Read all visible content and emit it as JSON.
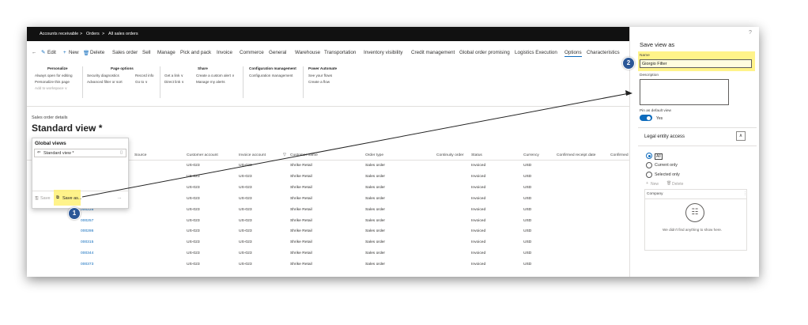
{
  "breadcrumb": {
    "item1": "Accounts receivable",
    "item2": "Orders",
    "item3": "All sales orders"
  },
  "actionbar": {
    "back": "←",
    "edit": "Edit",
    "new": "New",
    "delete": "Delete",
    "tabs": [
      "Sales order",
      "Sell",
      "Manage",
      "Pick and pack",
      "Invoice",
      "Commerce",
      "General",
      "Warehouse",
      "Transportation",
      "Inventory visibility",
      "Credit management",
      "Global order promising",
      "Logistics Execution",
      "Options",
      "Characteristics"
    ]
  },
  "ribbon": {
    "personalize_header": "Personalize",
    "personalize_items": [
      "Always open for editing",
      "Personalize this page",
      "Add to workspace ∨"
    ],
    "page_options_header": "Page options",
    "page_options_col1": [
      "Security diagnostics",
      "Advanced filter or sort"
    ],
    "page_options_col2": [
      "Record info",
      "Go to ∨"
    ],
    "share_header": "Share",
    "share_col1": [
      "Get a link ∨",
      "Direct link ∨"
    ],
    "share_col2": [
      "Create a custom alert ∨",
      "Manage my alerts"
    ],
    "config_header": "Configuration management",
    "config_items": [
      "Configuration management"
    ],
    "power_header": "Power Automate",
    "power_items": [
      "See your flows",
      "Create a flow"
    ]
  },
  "view": {
    "section_label": "Sales order details",
    "title": "Standard view *",
    "chevron": "⌄"
  },
  "views_popup": {
    "header": "Global views",
    "item": "Standard view *",
    "save": "Save",
    "save_as": "Save as...",
    "more": "..."
  },
  "table": {
    "headers": [
      "Source",
      "Customer account",
      "Invoice account",
      "Customer name",
      "Order type",
      "Continuity order",
      "Status",
      "Currency",
      "Confirmed receipt date",
      "Confirmed"
    ],
    "rows": [
      {
        "id": "",
        "cust": "US-023",
        "inv": "US-023",
        "name": "Shrike Retail",
        "type": "Sales order",
        "status": "Invoiced",
        "cur": "USD"
      },
      {
        "id": "",
        "cust": "US-023",
        "inv": "US-023",
        "name": "Shrike Retail",
        "type": "Sales order",
        "status": "Invoiced",
        "cur": "USD"
      },
      {
        "id": "",
        "cust": "US-023",
        "inv": "US-023",
        "name": "Shrike Retail",
        "type": "Sales order",
        "status": "Invoiced",
        "cur": "USD"
      },
      {
        "id": "",
        "cust": "US-023",
        "inv": "US-023",
        "name": "Shrike Retail",
        "type": "Sales order",
        "status": "Invoiced",
        "cur": "USD"
      },
      {
        "id": "000228",
        "cust": "US-023",
        "inv": "US-023",
        "name": "Shrike Retail",
        "type": "Sales order",
        "status": "Invoiced",
        "cur": "USD"
      },
      {
        "id": "000257",
        "cust": "US-023",
        "inv": "US-023",
        "name": "Shrike Retail",
        "type": "Sales order",
        "status": "Invoiced",
        "cur": "USD"
      },
      {
        "id": "000286",
        "cust": "US-023",
        "inv": "US-023",
        "name": "Shrike Retail",
        "type": "Sales order",
        "status": "Invoiced",
        "cur": "USD"
      },
      {
        "id": "000315",
        "cust": "US-023",
        "inv": "US-023",
        "name": "Shrike Retail",
        "type": "Sales order",
        "status": "Invoiced",
        "cur": "USD"
      },
      {
        "id": "000344",
        "cust": "US-023",
        "inv": "US-023",
        "name": "Shrike Retail",
        "type": "Sales order",
        "status": "Invoiced",
        "cur": "USD"
      },
      {
        "id": "000373",
        "cust": "US-023",
        "inv": "US-023",
        "name": "Shrike Retail",
        "type": "Sales order",
        "status": "Invoiced",
        "cur": "USD"
      }
    ]
  },
  "panel": {
    "help": "?",
    "title": "Save view as",
    "name_label": "Name",
    "name_value": "Giorgio Filter",
    "description_label": "Description",
    "description_value": "",
    "pin_label": "Pin as default view",
    "pin_value": "Yes",
    "legal_header": "Legal entity access",
    "legal_options": [
      "All",
      "Current only",
      "Selected only"
    ],
    "legal_selected": "All",
    "new_label": "New",
    "delete_label": "Delete",
    "company_header": "Company",
    "empty_text": "We didn't find anything to show here."
  },
  "callouts": {
    "step1": "1",
    "step2": "2"
  },
  "colors": {
    "topbar": "#111111",
    "accent": "#0f6cbd",
    "highlight": "#fff176",
    "badge": "#2b5797",
    "toggle": "#0f6cbd"
  }
}
